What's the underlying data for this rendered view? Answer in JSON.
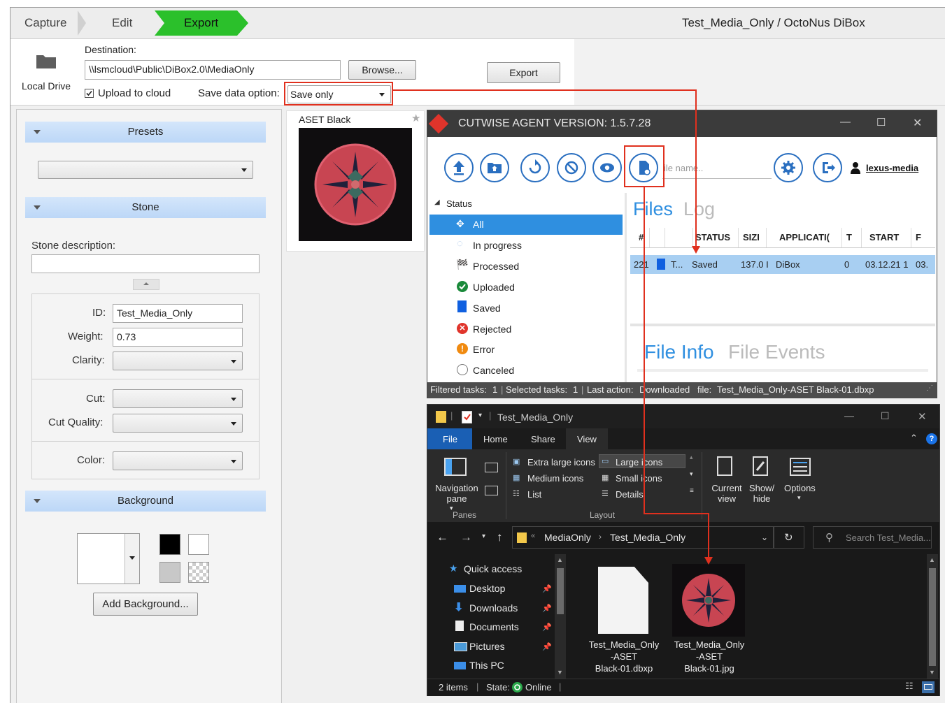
{
  "app": {
    "title": "Test_Media_Only / OctoNus DiBox",
    "steps": [
      "Capture",
      "Edit",
      "Export"
    ],
    "active_step": "Export"
  },
  "destination": {
    "drive_icon": "folder-icon",
    "drive_label": "Local Drive",
    "label": "Destination:",
    "path": "\\\\lsmcloud\\Public\\DiBox2.0\\MediaOnly",
    "browse_label": "Browse...",
    "export_label": "Export",
    "upload_checkbox_label": "Upload to cloud",
    "upload_checked": true,
    "save_option_label": "Save data option:",
    "save_option_value": "Save only"
  },
  "left_panel": {
    "presets": {
      "header": "Presets",
      "value": ""
    },
    "stone": {
      "header": "Stone",
      "description_label": "Stone description:",
      "description_value": "",
      "id_label": "ID:",
      "id_value": "Test_Media_Only",
      "weight_label": "Weight:",
      "weight_value": "0.73",
      "clarity_label": "Clarity:",
      "cut_label": "Cut:",
      "cut_quality_label": "Cut Quality:",
      "color_label": "Color:"
    },
    "background": {
      "header": "Background",
      "add_label": "Add Background...",
      "swatches": [
        "#ffffff",
        "#000000",
        "#ffffff",
        "#c8c8c8",
        "checker"
      ]
    }
  },
  "thumbnail": {
    "label": "ASET Black",
    "star_icon": "star-icon"
  },
  "cutwise": {
    "title": "CUTWISE AGENT VERSION: 1.5.7.28",
    "window_controls": [
      "—",
      "☐",
      "✕"
    ],
    "toolbar_icons": [
      "upload-icon",
      "upload-folder-icon",
      "refresh-icon",
      "cancel-icon",
      "view-icon",
      "save-file-icon",
      "settings-icon",
      "logout-icon"
    ],
    "search_placeholder": "ile name..",
    "user": "lexus-media",
    "status_tree_header": "Status",
    "statuses": [
      "All",
      "In progress",
      "Processed",
      "Uploaded",
      "Saved",
      "Rejected",
      "Error",
      "Canceled"
    ],
    "tabs": [
      "Files",
      "Log"
    ],
    "columns": [
      "#",
      "",
      "",
      "STATUS",
      "SIZI",
      "APPLICATI(",
      "T",
      "START",
      "F"
    ],
    "row": {
      "num": "221",
      "type": "T...",
      "status": "Saved",
      "size": "137.0 I",
      "application": "DiBox",
      "t": "0",
      "start": "03.12.21 1",
      "f": "03."
    },
    "info_tabs": [
      "File Info",
      "File Events"
    ],
    "statusbar": {
      "filtered": "Filtered tasks:",
      "filtered_count": "1",
      "selected": "Selected tasks:",
      "selected_count": "1",
      "last_action_label": "Last action:",
      "last_action": "Downloaded",
      "file_label": "file:",
      "file": "Test_Media_Only-ASET Black-01.dbxp"
    }
  },
  "explorer": {
    "title": "Test_Media_Only",
    "window_controls": [
      "—",
      "☐",
      "✕"
    ],
    "ribbon_tabs": [
      "File",
      "Home",
      "Share",
      "View"
    ],
    "panes_group": "Panes",
    "navigation_pane": "Navigation pane",
    "layout_group": "Layout",
    "layout_options": [
      "Extra large icons",
      "Large icons",
      "Medium icons",
      "Small icons",
      "List",
      "Details"
    ],
    "current_view": "Current view",
    "show_hide": "Show/ hide",
    "options": "Options",
    "breadcrumb": [
      "MediaOnly",
      "Test_Media_Only"
    ],
    "search_placeholder": "Search Test_Media...",
    "nav_items": [
      "Quick access",
      "Desktop",
      "Downloads",
      "Documents",
      "Pictures",
      "This PC"
    ],
    "files": [
      {
        "name": "Test_Media_Only-ASET Black-01.dbxp",
        "line1": "Test_Media_Only",
        "line2": "-ASET",
        "line3": "Black-01.dbxp"
      },
      {
        "name": "Test_Media_Only-ASET Black-01.jpg",
        "line1": "Test_Media_Only",
        "line2": "-ASET",
        "line3": "Black-01.jpg"
      }
    ],
    "status_items": "2 items",
    "state_label": "State:",
    "state_value": "Online"
  },
  "colors": {
    "accent": "#2a6fc0",
    "export_green": "#2bc02b",
    "annotation_red": "#e0301e"
  }
}
